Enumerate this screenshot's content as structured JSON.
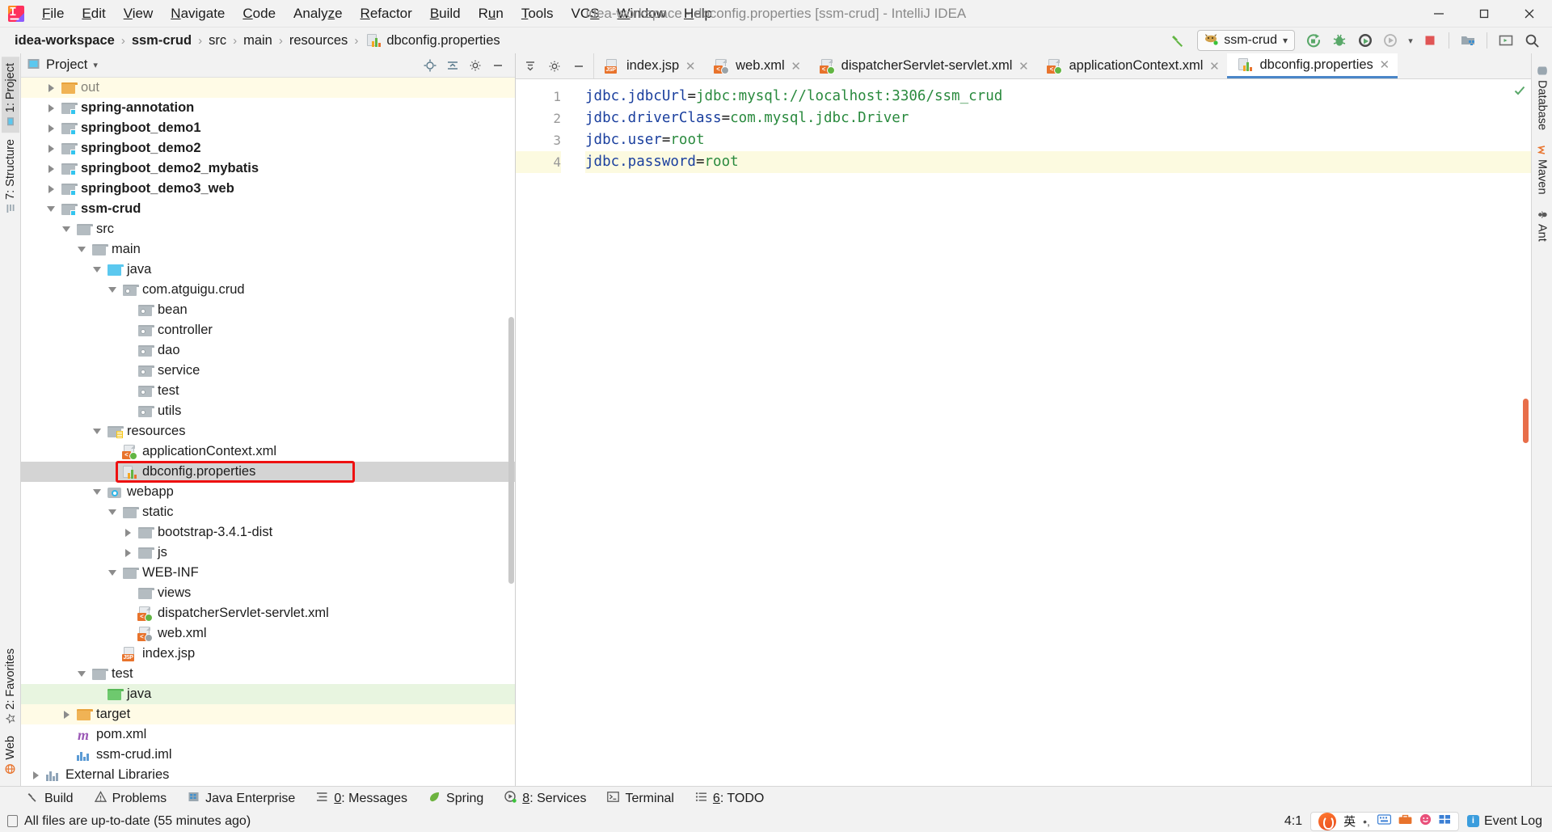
{
  "window": {
    "title": "idea-workspace - dbconfig.properties [ssm-crud] - IntelliJ IDEA",
    "minimize_label": "─",
    "maximize_label": "❐",
    "close_label": "✕",
    "logo_icon": "intellij-idea-logo"
  },
  "menubar": {
    "items": [
      {
        "label": "File"
      },
      {
        "label": "Edit"
      },
      {
        "label": "View"
      },
      {
        "label": "Navigate"
      },
      {
        "label": "Code"
      },
      {
        "label": "Analyze"
      },
      {
        "label": "Refactor"
      },
      {
        "label": "Build"
      },
      {
        "label": "Run"
      },
      {
        "label": "Tools"
      },
      {
        "label": "VCS"
      },
      {
        "label": "Window"
      },
      {
        "label": "Help"
      }
    ]
  },
  "breadcrumb": {
    "separator": "›",
    "items": [
      {
        "label": "idea-workspace",
        "bold": true
      },
      {
        "label": "ssm-crud",
        "bold": true
      },
      {
        "label": "src",
        "bold": false
      },
      {
        "label": "main",
        "bold": false
      },
      {
        "label": "resources",
        "bold": false
      },
      {
        "label": "dbconfig.properties",
        "bold": false,
        "icon": "properties-file-icon"
      }
    ]
  },
  "toolbar": {
    "build_icon": "hammer-build-icon",
    "run_config": {
      "label": "ssm-crud",
      "icon": "tomcat-cat-icon",
      "chevron": "▾"
    },
    "run_icon": "run-icon",
    "debug_icon": "debug-bug-icon",
    "run_coverage_icon": "run-with-coverage-icon",
    "profile_icon": "profiler-icon",
    "profile_chevron": "▾",
    "stop_icon": "stop-icon",
    "project_structure_icon": "project-structure-icon",
    "console_icon": "console-icon",
    "search_icon": "search-everywhere-icon"
  },
  "project_panel": {
    "title": "Project",
    "title_chevron": "▾",
    "header_icons": [
      "locate-target-icon",
      "collapse-all-icon",
      "settings-gear-icon",
      "hide-panel-icon"
    ],
    "tree": [
      {
        "label": "out",
        "depth": 2,
        "twisty": "right",
        "icon": "folder-orange",
        "bold": false,
        "cut": true,
        "rowbg": "yellow"
      },
      {
        "label": "spring-annotation",
        "depth": 2,
        "twisty": "right",
        "icon": "module-folder",
        "bold": true
      },
      {
        "label": "springboot_demo1",
        "depth": 2,
        "twisty": "right",
        "icon": "module-folder",
        "bold": true
      },
      {
        "label": "springboot_demo2",
        "depth": 2,
        "twisty": "right",
        "icon": "module-folder",
        "bold": true
      },
      {
        "label": "springboot_demo2_mybatis",
        "depth": 2,
        "twisty": "right",
        "icon": "module-folder",
        "bold": true
      },
      {
        "label": "springboot_demo3_web",
        "depth": 2,
        "twisty": "right",
        "icon": "module-folder",
        "bold": true
      },
      {
        "label": "ssm-crud",
        "depth": 2,
        "twisty": "down",
        "icon": "module-folder",
        "bold": true
      },
      {
        "label": "src",
        "depth": 3,
        "twisty": "down",
        "icon": "folder-gray",
        "bold": false
      },
      {
        "label": "main",
        "depth": 4,
        "twisty": "down",
        "icon": "folder-gray",
        "bold": false
      },
      {
        "label": "java",
        "depth": 5,
        "twisty": "down",
        "icon": "folder-source-blue",
        "bold": false
      },
      {
        "label": "com.atguigu.crud",
        "depth": 6,
        "twisty": "down",
        "icon": "package-icon",
        "bold": false
      },
      {
        "label": "bean",
        "depth": 7,
        "twisty": "none",
        "icon": "package-icon",
        "bold": false
      },
      {
        "label": "controller",
        "depth": 7,
        "twisty": "none",
        "icon": "package-icon",
        "bold": false
      },
      {
        "label": "dao",
        "depth": 7,
        "twisty": "none",
        "icon": "package-icon",
        "bold": false
      },
      {
        "label": "service",
        "depth": 7,
        "twisty": "none",
        "icon": "package-icon",
        "bold": false
      },
      {
        "label": "test",
        "depth": 7,
        "twisty": "none",
        "icon": "package-icon",
        "bold": false
      },
      {
        "label": "utils",
        "depth": 7,
        "twisty": "none",
        "icon": "package-icon",
        "bold": false
      },
      {
        "label": "resources",
        "depth": 5,
        "twisty": "down",
        "icon": "folder-resources",
        "bold": false
      },
      {
        "label": "applicationContext.xml",
        "depth": 6,
        "twisty": "none",
        "icon": "spring-xml-icon",
        "bold": false
      },
      {
        "label": "dbconfig.properties",
        "depth": 6,
        "twisty": "none",
        "icon": "properties-file-icon",
        "bold": false,
        "selected": true,
        "annotated": true
      },
      {
        "label": "webapp",
        "depth": 5,
        "twisty": "down",
        "icon": "folder-web",
        "bold": false
      },
      {
        "label": "static",
        "depth": 6,
        "twisty": "down",
        "icon": "folder-gray",
        "bold": false
      },
      {
        "label": "bootstrap-3.4.1-dist",
        "depth": 7,
        "twisty": "right",
        "icon": "folder-gray",
        "bold": false
      },
      {
        "label": "js",
        "depth": 7,
        "twisty": "right",
        "icon": "folder-gray",
        "bold": false
      },
      {
        "label": "WEB-INF",
        "depth": 6,
        "twisty": "down",
        "icon": "folder-gray",
        "bold": false
      },
      {
        "label": "views",
        "depth": 7,
        "twisty": "none",
        "icon": "folder-gray",
        "bold": false
      },
      {
        "label": "dispatcherServlet-servlet.xml",
        "depth": 7,
        "twisty": "none",
        "icon": "spring-xml-icon",
        "bold": false
      },
      {
        "label": "web.xml",
        "depth": 7,
        "twisty": "none",
        "icon": "xml-file-icon",
        "bold": false
      },
      {
        "label": "index.jsp",
        "depth": 6,
        "twisty": "none",
        "icon": "jsp-file-icon",
        "bold": false
      },
      {
        "label": "test",
        "depth": 4,
        "twisty": "down",
        "icon": "folder-gray",
        "bold": false
      },
      {
        "label": "java",
        "depth": 5,
        "twisty": "none",
        "icon": "folder-test-green",
        "bold": false,
        "rowbg": "green"
      },
      {
        "label": "target",
        "depth": 3,
        "twisty": "right",
        "icon": "folder-orange",
        "bold": false,
        "rowbg": "yellow"
      },
      {
        "label": "pom.xml",
        "depth": 3,
        "twisty": "none",
        "icon": "maven-pom-icon",
        "bold": false
      },
      {
        "label": "ssm-crud.iml",
        "depth": 3,
        "twisty": "none",
        "icon": "iml-module-icon",
        "bold": false
      },
      {
        "label": "External Libraries",
        "depth": 1,
        "twisty": "right",
        "icon": "external-libraries-icon",
        "bold": false
      }
    ]
  },
  "left_rail": {
    "items": [
      {
        "label": "1: Project",
        "icon": "project-icon",
        "active": true
      },
      {
        "label": "7: Structure",
        "icon": "structure-icon",
        "active": false
      },
      {
        "label": "2: Favorites",
        "icon": "favorites-star-icon",
        "active": false
      },
      {
        "label": "Web",
        "icon": "web-globe-icon",
        "active": false
      }
    ]
  },
  "right_rail": {
    "items": [
      {
        "label": "Database",
        "icon": "database-icon"
      },
      {
        "label": "Maven",
        "icon": "maven-m-icon"
      },
      {
        "label": "Ant",
        "icon": "ant-icon"
      }
    ]
  },
  "editor": {
    "tab_actions": [
      "sort-tabs-icon",
      "settings-gear-icon",
      "hide-editor-icon"
    ],
    "tabs": [
      {
        "label": "index.jsp",
        "icon": "jsp-file-icon",
        "close": "✕",
        "active": false
      },
      {
        "label": "web.xml",
        "icon": "xml-file-icon",
        "close": "✕",
        "active": false
      },
      {
        "label": "dispatcherServlet-servlet.xml",
        "icon": "spring-xml-icon",
        "close": "✕",
        "active": false
      },
      {
        "label": "applicationContext.xml",
        "icon": "spring-xml-icon",
        "close": "✕",
        "active": false
      },
      {
        "label": "dbconfig.properties",
        "icon": "properties-file-icon",
        "close": "✕",
        "active": true
      }
    ],
    "inspection_status_icon": "inspections-ok-checkmark",
    "lines": [
      {
        "num": "1",
        "key": "jdbc.jdbcUrl",
        "eq": "=",
        "value": "jdbc:mysql://localhost:3306/ssm_crud",
        "highlight": false
      },
      {
        "num": "2",
        "key": "jdbc.driverClass",
        "eq": "=",
        "value": "com.mysql.jdbc.Driver",
        "highlight": false
      },
      {
        "num": "3",
        "key": "jdbc.user",
        "eq": "=",
        "value": "root",
        "highlight": false
      },
      {
        "num": "4",
        "key": "jdbc.password",
        "eq": "=",
        "value": "root",
        "highlight": true
      }
    ]
  },
  "tool_windows": {
    "items": [
      {
        "label": "Build",
        "icon": "build-hammer-icon"
      },
      {
        "label": "Problems",
        "icon": "problems-warning-icon"
      },
      {
        "label": "Java Enterprise",
        "icon": "java-enterprise-icon"
      },
      {
        "label": "0: Messages",
        "icon": "messages-icon",
        "mnemonic": "0"
      },
      {
        "label": "Spring",
        "icon": "spring-leaf-icon"
      },
      {
        "label": "8: Services",
        "icon": "services-icon",
        "mnemonic": "8"
      },
      {
        "label": "Terminal",
        "icon": "terminal-icon"
      },
      {
        "label": "6: TODO",
        "icon": "todo-list-icon",
        "mnemonic": "6"
      }
    ]
  },
  "statusbar": {
    "message": "All files are up-to-date (55 minutes ago)",
    "message_icon": "document-icon",
    "caret_position": "4:1",
    "ime": {
      "app_icon": "sogou-pinyin-icon",
      "mode": "英",
      "punct": "•,",
      "items": [
        "keyboard-icon",
        "toolbox-icon",
        "emoji-icon",
        "grid-menu-icon"
      ]
    },
    "event_log": {
      "label": "Event Log",
      "icon": "event-log-icon"
    }
  },
  "colors": {
    "accent_blue": "#4a86c8",
    "key_blue": "#1a3f9e",
    "value_green": "#2a8a3e",
    "annotation_red": "#ee1111",
    "selection_gray": "#d4d4d4",
    "panel_bg": "#f2f2f2"
  }
}
